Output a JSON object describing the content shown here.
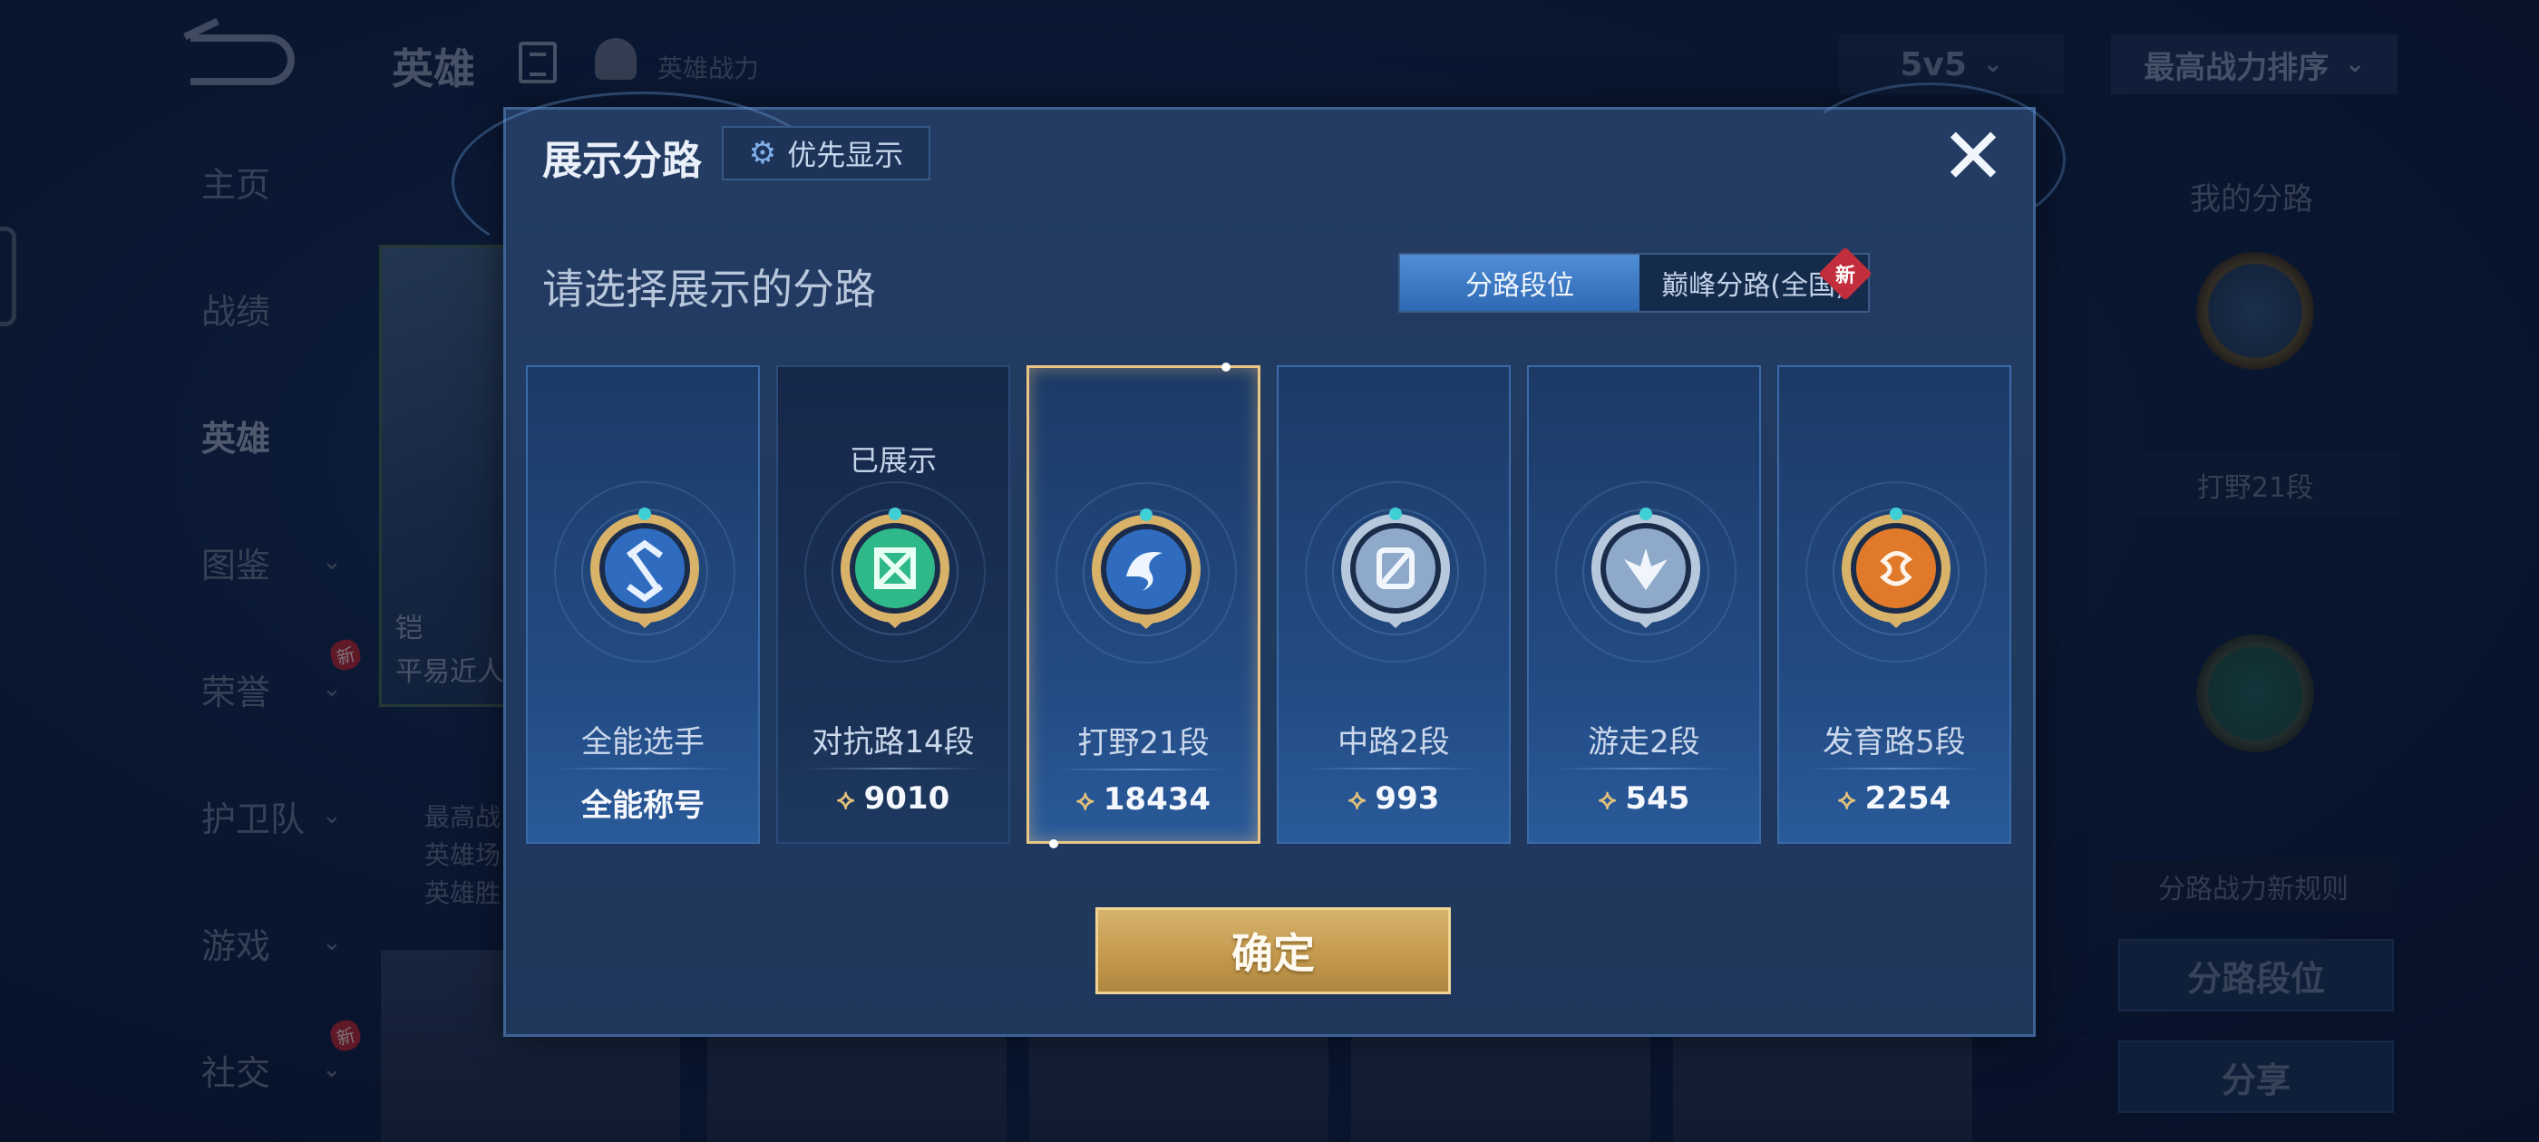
{
  "background": {
    "page_title": "英雄",
    "power_label": "英雄战力",
    "mode_select": "5v5",
    "sort_select": "最高战力排序",
    "nav": [
      {
        "label": "主页",
        "active": false,
        "caret": false,
        "new": false
      },
      {
        "label": "战绩",
        "active": false,
        "caret": false,
        "new": false
      },
      {
        "label": "英雄",
        "active": true,
        "caret": false,
        "new": false
      },
      {
        "label": "图鉴",
        "active": false,
        "caret": true,
        "new": false
      },
      {
        "label": "荣誉",
        "active": false,
        "caret": true,
        "new": true
      },
      {
        "label": "护卫队",
        "active": false,
        "caret": true,
        "new": false
      },
      {
        "label": "游戏",
        "active": false,
        "caret": true,
        "new": false
      },
      {
        "label": "社交",
        "active": false,
        "caret": true,
        "new": true
      }
    ],
    "new_badge": "新",
    "hero": {
      "name": "铠",
      "subtitle": "平易近人",
      "stats": [
        "最高战",
        "英雄场",
        "英雄胜"
      ]
    },
    "right_panel": {
      "title": "我的分路",
      "lane": "打野21段",
      "rule": "分路战力新规则",
      "btn_segment": "分路段位",
      "btn_share": "分享"
    }
  },
  "modal": {
    "title": "展示分路",
    "priority_button": "优先显示",
    "subtitle": "请选择展示的分路",
    "tabs": {
      "active": "分路段位",
      "inactive": "巅峰分路(全国)",
      "new_badge": "新"
    },
    "shown_label": "已展示",
    "cards": [
      {
        "name": "全能选手",
        "value": "全能称号",
        "emblem": "allround",
        "shown": false,
        "selected": false,
        "dark": false,
        "icon": false
      },
      {
        "name": "对抗路14段",
        "value": "9010",
        "emblem": "clash",
        "shown": true,
        "selected": false,
        "dark": true,
        "icon": true
      },
      {
        "name": "打野21段",
        "value": "18434",
        "emblem": "jungle",
        "shown": false,
        "selected": true,
        "dark": false,
        "icon": true
      },
      {
        "name": "中路2段",
        "value": "993",
        "emblem": "mid",
        "shown": false,
        "selected": false,
        "dark": false,
        "icon": true
      },
      {
        "name": "游走2段",
        "value": "545",
        "emblem": "roam",
        "shown": false,
        "selected": false,
        "dark": false,
        "icon": true
      },
      {
        "name": "发育路5段",
        "value": "2254",
        "emblem": "farm",
        "shown": false,
        "selected": false,
        "dark": false,
        "icon": true
      }
    ],
    "confirm": "确定"
  },
  "colors": {
    "gold": "#d7b36c",
    "selected_border": "#e9c686",
    "tab_active": "#3f7ccb",
    "emblem_blue": "#2f6cc0",
    "emblem_green": "#2fb98a",
    "emblem_silver": "#8ea9c9",
    "emblem_orange": "#e07a2a"
  }
}
